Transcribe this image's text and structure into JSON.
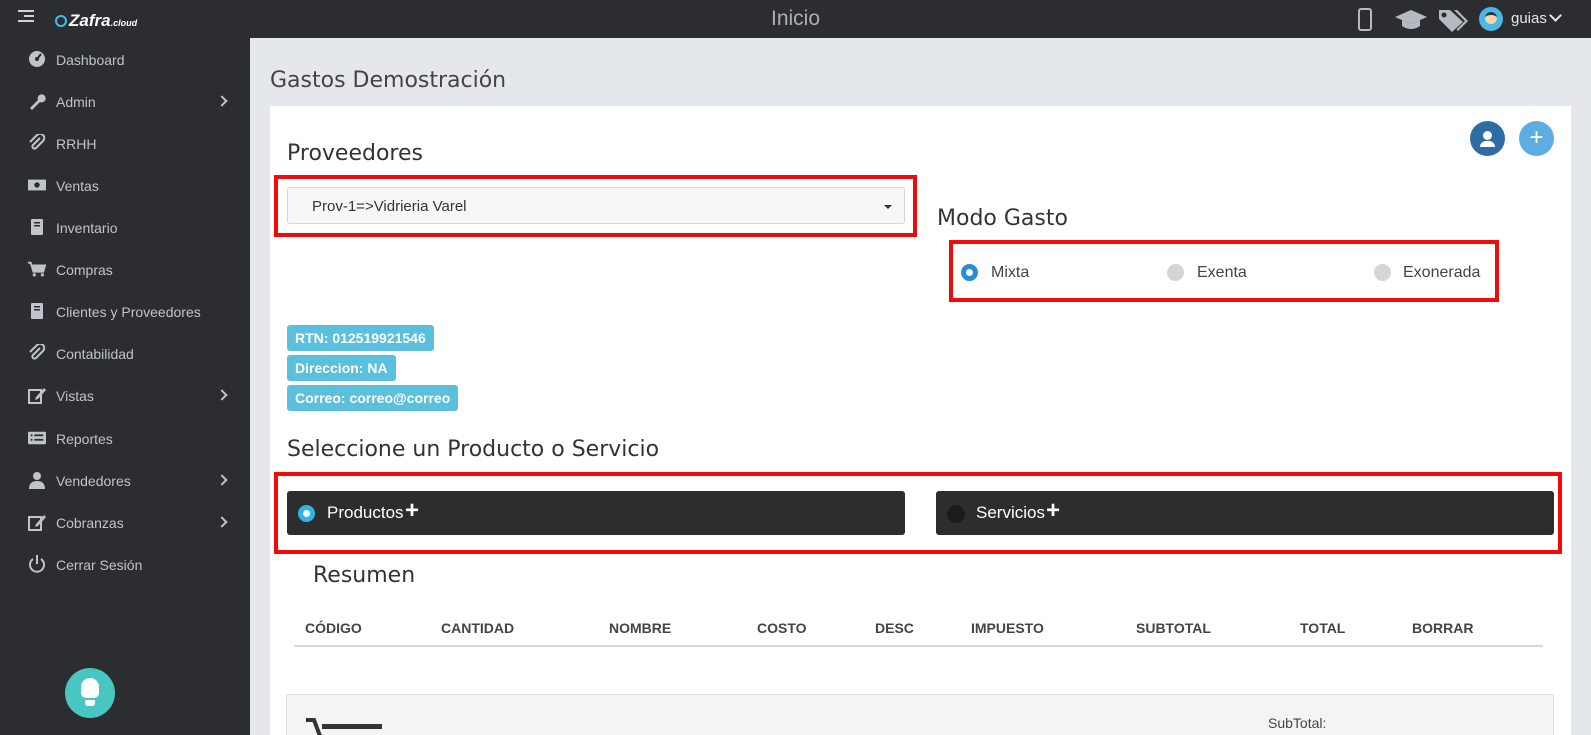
{
  "header": {
    "logo_text": "Zafra",
    "logo_sub": ".cloud",
    "title": "Inicio",
    "user": "guias",
    "icons": [
      "mobile-icon",
      "graduation-cap-icon",
      "tags-icon",
      "user-avatar"
    ]
  },
  "sidebar": {
    "items": [
      {
        "label": "Dashboard",
        "icon": "dashboard-icon",
        "submenu": false
      },
      {
        "label": "Admin",
        "icon": "wrench-icon",
        "submenu": true
      },
      {
        "label": "RRHH",
        "icon": "paperclip-icon",
        "submenu": false
      },
      {
        "label": "Ventas",
        "icon": "money-icon",
        "submenu": false
      },
      {
        "label": "Inventario",
        "icon": "book-icon",
        "submenu": false
      },
      {
        "label": "Compras",
        "icon": "cart-icon",
        "submenu": false
      },
      {
        "label": "Clientes y Proveedores",
        "icon": "book-icon",
        "submenu": false
      },
      {
        "label": "Contabilidad",
        "icon": "paperclip-icon",
        "submenu": false
      },
      {
        "label": "Vistas",
        "icon": "edit-icon",
        "submenu": true
      },
      {
        "label": "Reportes",
        "icon": "list-icon",
        "submenu": false
      },
      {
        "label": "Vendedores",
        "icon": "user-icon",
        "submenu": true
      },
      {
        "label": "Cobranzas",
        "icon": "edit-icon",
        "submenu": true
      },
      {
        "label": "Cerrar Sesión",
        "icon": "power-icon",
        "submenu": false
      }
    ]
  },
  "main": {
    "page_title": "Gastos Demostración",
    "proveedores_label": "Proveedores",
    "proveedor_selected": "Prov-1=>Vidrieria Varel",
    "modo_gasto_label": "Modo Gasto",
    "modo_options": [
      {
        "label": "Mixta",
        "selected": true
      },
      {
        "label": "Exenta",
        "selected": false
      },
      {
        "label": "Exonerada",
        "selected": false
      }
    ],
    "badges": {
      "rtn": "RTN: 012519921546",
      "direccion": "Direccion: NA",
      "correo": "Correo: correo@correo"
    },
    "seleccione_label": "Seleccione un Producto o Servicio",
    "tipo_options": [
      {
        "label": "Productos",
        "selected": true
      },
      {
        "label": "Servicios",
        "selected": false
      }
    ],
    "resumen_label": "Resumen",
    "table_headers": [
      "CÓDIGO",
      "CANTIDAD",
      "NOMBRE",
      "COSTO",
      "DESC",
      "IMPUESTO",
      "SUBTOTAL",
      "TOTAL",
      "BORRAR"
    ],
    "subtotal_label": "SubTotal:"
  },
  "colors": {
    "sidebar_bg": "#2b2d31",
    "highlight_red": "#f00a0a",
    "badge_blue": "#5bc0de",
    "radio_blue": "#2a8bd6"
  }
}
